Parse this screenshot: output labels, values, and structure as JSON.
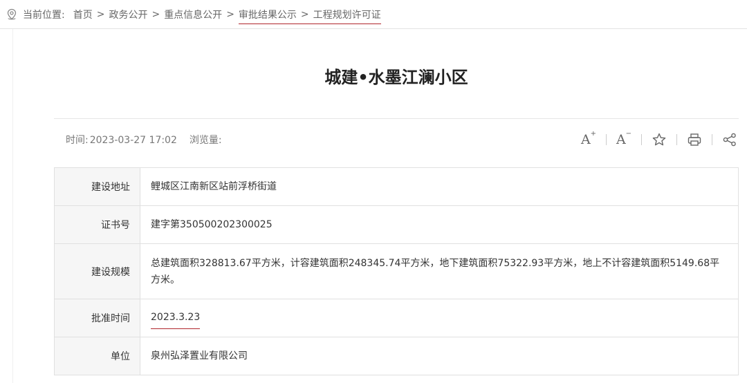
{
  "breadcrumb": {
    "label": "当前位置:",
    "items": [
      "首页",
      "政务公开",
      "重点信息公开",
      "审批结果公示",
      "工程规划许可证"
    ],
    "separator": ">"
  },
  "article": {
    "title": "城建•水墨江澜小区",
    "time_label": "时间:",
    "time_value": "2023-03-27 17:02",
    "views_label": "浏览量:"
  },
  "tools": [
    "font-increase-icon",
    "font-decrease-icon",
    "star-icon",
    "print-icon",
    "share-icon"
  ],
  "info_table": [
    {
      "label": "建设地址",
      "value": "鲤城区江南新区站前浮桥街道"
    },
    {
      "label": "证书号",
      "value": "建字第350500202300025"
    },
    {
      "label": "建设规模",
      "value": "总建筑面积328813.67平方米，计容建筑面积248345.74平方米，地下建筑面积75322.93平方米，地上不计容建筑面积5149.68平方米。"
    },
    {
      "label": "批准时间",
      "value": "2023.3.23"
    },
    {
      "label": "单位",
      "value": "泉州弘泽置业有限公司"
    }
  ],
  "colors": {
    "accent": "#b0252b",
    "label_bg": "#f6f6f6",
    "border": "#e0e0e0"
  }
}
